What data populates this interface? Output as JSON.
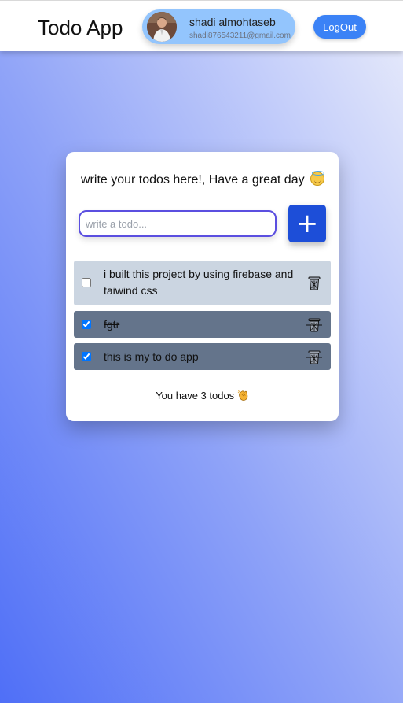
{
  "navbar": {
    "title": "Todo App",
    "user": {
      "name": "shadi almohtaseb",
      "email": "shadi876543211@gmail.com",
      "avatar_icon": "user-avatar-photo"
    },
    "logout_label": "LogOut"
  },
  "card": {
    "heading": "write your todos here!, Have a great day",
    "heading_emoji": "smiling-face-with-halo-icon",
    "input": {
      "placeholder": "write a todo...",
      "value": ""
    },
    "add_button_label": "+",
    "todos": [
      {
        "text": "i built this project by using firebase and taiwind css",
        "completed": false
      },
      {
        "text": "fgtr",
        "completed": true
      },
      {
        "text": "this is my to do app",
        "completed": true
      }
    ],
    "footer": {
      "count_text": "You have 3 todos",
      "emoji": "clapping-hands-icon"
    }
  },
  "colors": {
    "accent": "#3b82f6",
    "add_button": "#1d4ed8",
    "pill": "#93c5fd",
    "todo_active_bg": "#cbd5e1",
    "todo_done_bg": "#64748b",
    "input_border": "#5b4fe0"
  }
}
